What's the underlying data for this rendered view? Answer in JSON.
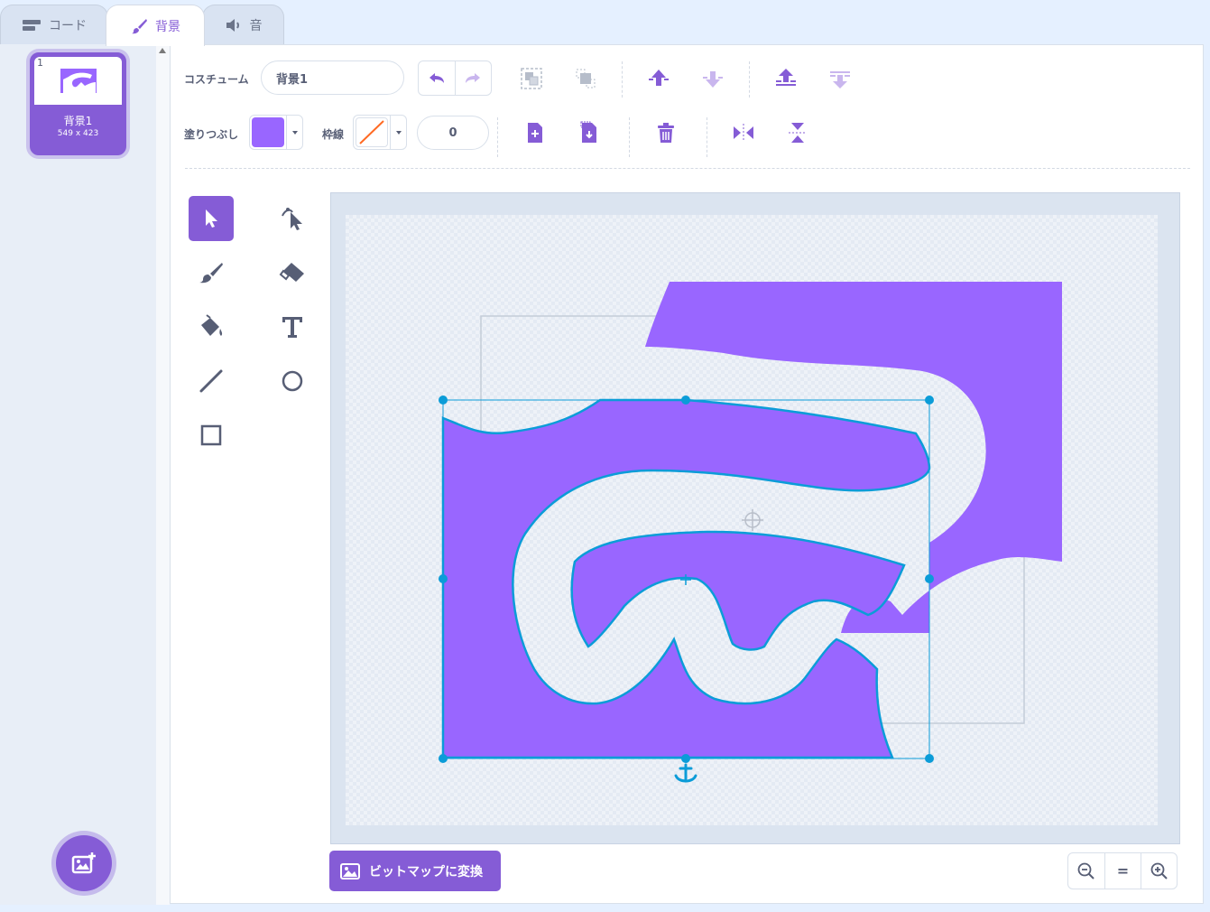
{
  "tabs": [
    {
      "label": "コード",
      "icon": "code-icon",
      "active": false
    },
    {
      "label": "背景",
      "icon": "brush-icon",
      "active": true
    },
    {
      "label": "音",
      "icon": "speaker-icon",
      "active": false
    }
  ],
  "costume_list": {
    "items": [
      {
        "number": "1",
        "name": "背景1",
        "size": "549 x 423",
        "selected": true
      }
    ],
    "add_button_icon": "add-backdrop-icon"
  },
  "toolbar": {
    "costume_label": "コスチューム",
    "costume_name": "背景1",
    "fill_label": "塗りつぶし",
    "outline_label": "枠線",
    "outline_width": "0",
    "colors": {
      "fill": "#9966ff",
      "outline": "none",
      "accent": "#855cd6",
      "selection": "#0b9cd8"
    },
    "icons": [
      "undo-icon",
      "redo-icon",
      "group-icon",
      "ungroup-icon",
      "forward-icon",
      "backward-icon",
      "front-icon",
      "back-icon",
      "copy-icon",
      "paste-icon",
      "delete-icon",
      "flip-horizontal-icon",
      "flip-vertical-icon"
    ]
  },
  "tools": [
    "select-tool",
    "reshape-tool",
    "brush-tool",
    "eraser-tool",
    "fill-tool",
    "text-tool",
    "line-tool",
    "circle-tool",
    "rectangle-tool"
  ],
  "canvas": {
    "selected_shape_fill": "#9966ff"
  },
  "bottom": {
    "bitmap_button_label": "ビットマップに変換",
    "zoom_out_icon": "zoom-out-icon",
    "zoom_reset_label": "=",
    "zoom_in_icon": "zoom-in-icon"
  }
}
